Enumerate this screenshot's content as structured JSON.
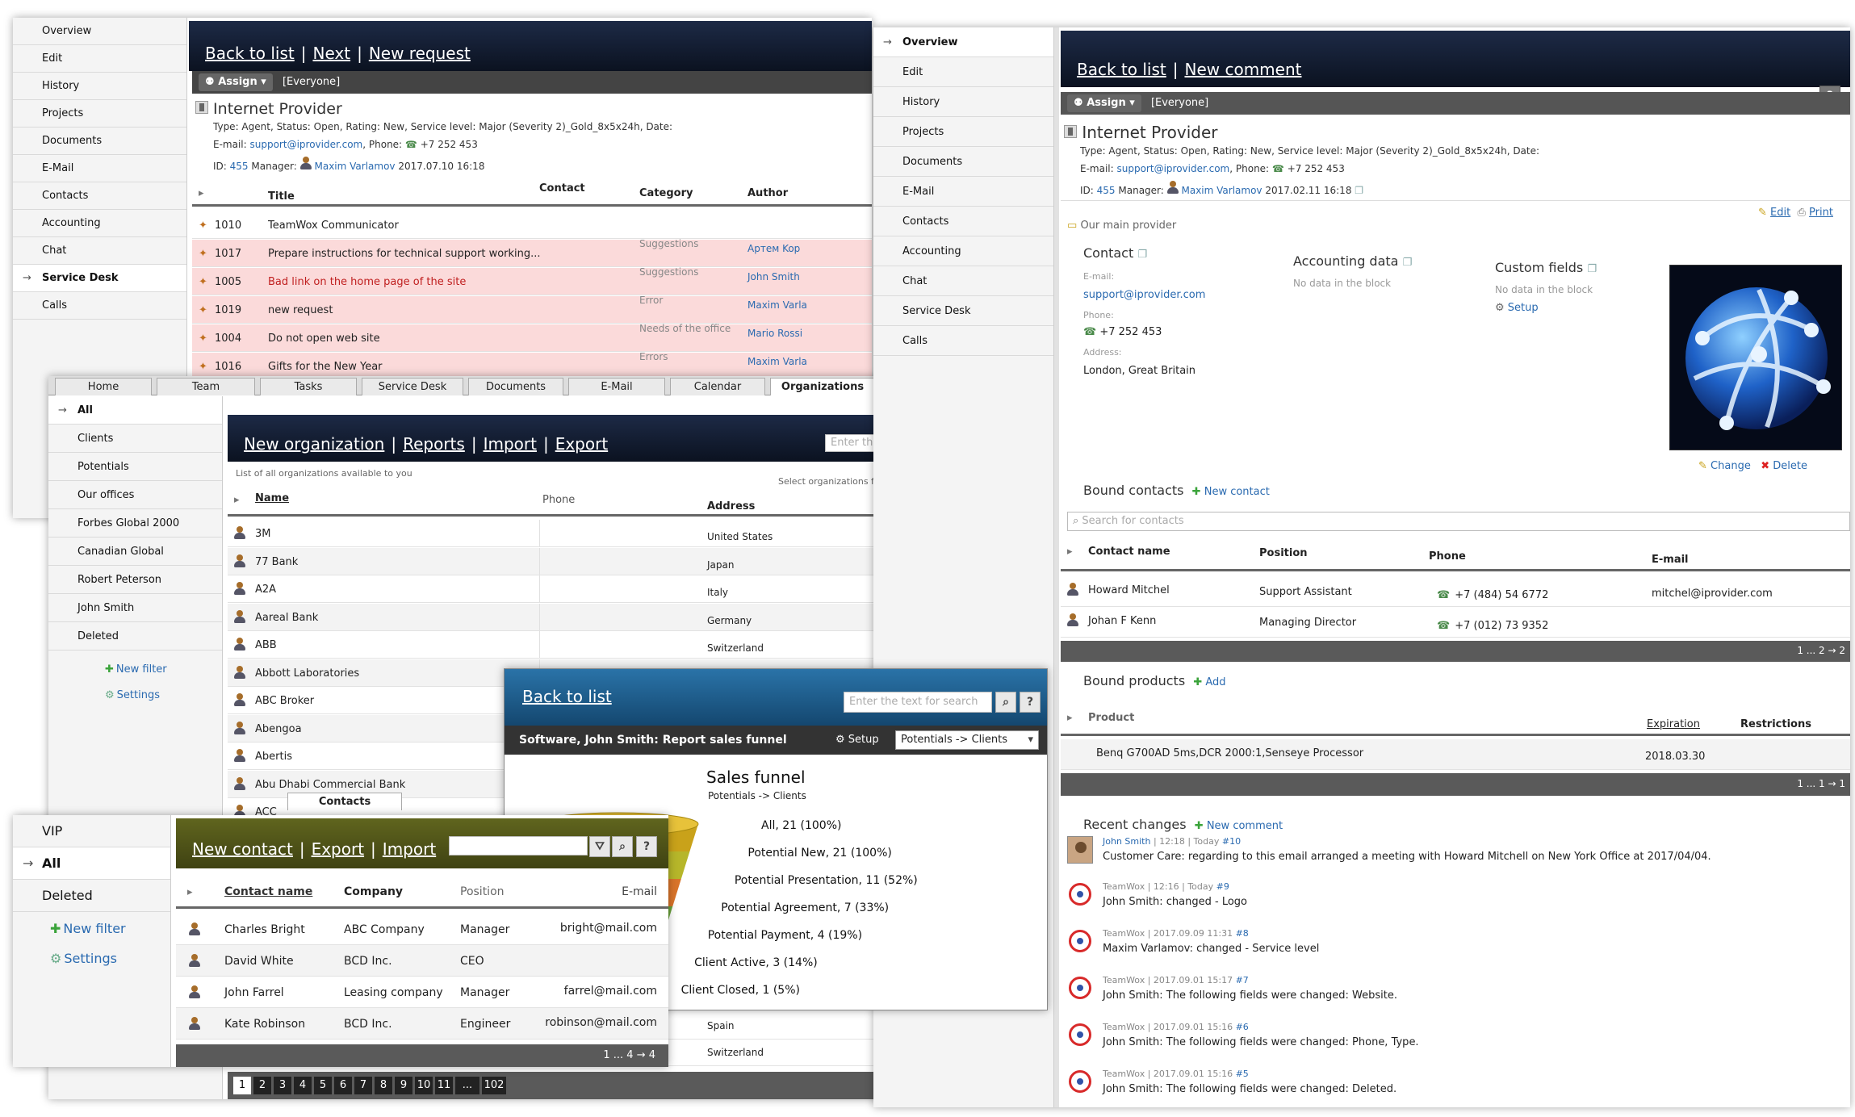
{
  "w1": {
    "sidebar": [
      "Overview",
      "Edit",
      "History",
      "Projects",
      "Documents",
      "E-Mail",
      "Contacts",
      "Accounting",
      "Chat",
      "Service Desk",
      "Calls"
    ],
    "links": [
      "Back to list",
      "Next",
      "New request"
    ],
    "assign": "Assign",
    "everyone": "[Everyone]",
    "org_name": "Internet Provider",
    "l1": "Type: Agent, Status: Open, Rating: New, Service level: Major (Severity 2)_Gold_8x5x24h, Date:",
    "email_lbl": "E-mail:",
    "email": "support@iprovider.com",
    "phone_lbl": ", Phone:",
    "phone": "+7 252 453",
    "id_lbl": "ID:",
    "id": "455",
    "mgr_lbl": "Manager:",
    "mgr": "Maxim Varlamov",
    "date": "2017.07.10 16:18",
    "cols": [
      "Title",
      "Contact",
      "Category",
      "Author"
    ],
    "rows": [
      {
        "id": "1010",
        "title": "TeamWox Communicator",
        "cat": "",
        "author": ""
      },
      {
        "id": "1017",
        "title": "Prepare instructions for technical support working...",
        "cat": "Suggestions",
        "author": "Артем Kop"
      },
      {
        "id": "1005",
        "title": "Bad link on the home page of the site",
        "cat": "Suggestions",
        "author": "John Smith"
      },
      {
        "id": "1019",
        "title": "new request",
        "cat": "Error",
        "author": "Maxim Varla"
      },
      {
        "id": "1004",
        "title": "Do not open web site",
        "cat": "Needs of the office",
        "author": "Mario Rossi"
      },
      {
        "id": "1016",
        "title": "Gifts for the New Year",
        "cat": "Errors",
        "author": "Maxim Varla"
      }
    ],
    "lastcat": "Needs of the office",
    "lastauthor": "John Smith"
  },
  "w2": {
    "tabs": [
      "Home",
      "Team",
      "Tasks",
      "Service Desk",
      "Documents",
      "E-Mail",
      "Calendar",
      "Organizations"
    ],
    "sidebar": [
      "All",
      "Clients",
      "Potentials",
      "Our offices",
      "Forbes Global 2000",
      "Canadian Global",
      "Robert Peterson",
      "John Smith",
      "Deleted"
    ],
    "new_filter": "New filter",
    "settings": "Settings",
    "links": [
      "New organization",
      "Reports",
      "Import",
      "Export"
    ],
    "search_ph": "Enter th",
    "subtitle": "List of all organizations available to you",
    "select_note": "Select organizations f",
    "cols": [
      "Name",
      "Phone",
      "Address"
    ],
    "rows": [
      {
        "name": "3M",
        "addr": "United States"
      },
      {
        "name": "77 Bank",
        "addr": "Japan"
      },
      {
        "name": "A2A",
        "addr": "Italy"
      },
      {
        "name": "Aareal Bank",
        "addr": "Germany"
      },
      {
        "name": "ABB",
        "addr": "Switzerland"
      },
      {
        "name": "Abbott Laboratories",
        "addr": ""
      },
      {
        "name": "ABC Broker",
        "addr": ""
      },
      {
        "name": "Abengoa",
        "addr": ""
      },
      {
        "name": "Abertis",
        "addr": ""
      },
      {
        "name": "Abu Dhabi Commercial Bank",
        "addr": ""
      },
      {
        "name": "ACC",
        "addr": ""
      }
    ],
    "extra_addr": [
      "Spain",
      "Switzerland"
    ],
    "contacts_tab": "Contacts",
    "pages": [
      "1",
      "2",
      "3",
      "4",
      "5",
      "6",
      "7",
      "8",
      "9",
      "10",
      "11",
      "...",
      "102"
    ]
  },
  "w3": {
    "sidebar": [
      "Overview",
      "Edit",
      "History",
      "Projects",
      "Documents",
      "E-Mail",
      "Contacts",
      "Accounting",
      "Chat",
      "Service Desk",
      "Calls"
    ],
    "links": [
      "Back to list",
      "New comment"
    ],
    "help": "?",
    "assign": "Assign",
    "everyone": "[Everyone]",
    "org_name": "Internet Provider",
    "l1": "Type: Agent, Status: Open, Rating: New, Service level: Major (Severity 2)_Gold_8x5x24h, Date:",
    "email_lbl": "E-mail:",
    "email": "support@iprovider.com",
    "phone_lbl": ", Phone:",
    "phone": "+7 252 453",
    "id_lbl": "ID:",
    "id": "455",
    "mgr_lbl": "Manager:",
    "mgr": "Maxim Varlamov",
    "date": "2017.02.11 16:18",
    "edit": "Edit",
    "print": "Print",
    "main_provider": "Our main provider",
    "contact_h": "Contact",
    "email_small": "E-mail:",
    "email_val": "support@iprovider.com",
    "phone_small": "Phone:",
    "phone_val": "+7 252 453",
    "addr_small": "Address:",
    "addr_val": "London, Great Britain",
    "acc_h": "Accounting data",
    "acc_nodata": "No data in the block",
    "cf_h": "Custom fields",
    "cf_nodata": "No data in the block",
    "setup": "Setup",
    "change": "Change",
    "delete": "Delete",
    "bound_contacts": "Bound contacts",
    "new_contact": "New contact",
    "search_contacts": "Search for contacts",
    "bc_cols": [
      "Contact name",
      "Position",
      "Phone",
      "E-mail"
    ],
    "bc_rows": [
      {
        "name": "Howard Mitchel",
        "pos": "Support Assistant",
        "phone": "+7 (484) 54 6772",
        "email": "mitchel@iprovider.com"
      },
      {
        "name": "Johan F Kenn",
        "pos": "Managing Director",
        "phone": "+7 (012) 73 9352",
        "email": ""
      }
    ],
    "bc_pager": "1 ... 2 → 2",
    "bound_products": "Bound products",
    "add": "Add",
    "bp_cols": [
      "Product",
      "Expiration",
      "Restrictions"
    ],
    "bp_row": {
      "product": "Benq G700AD 5ms,DCR 2000:1,Senseye Processor",
      "exp": "2018.03.30"
    },
    "bp_pager": "1 ... 1 → 1",
    "recent": "Recent changes",
    "new_comment": "New comment",
    "changes": [
      {
        "meta_a": "John Smith",
        "meta_b": " | 12:18 | Today ",
        "num": "#10",
        "text": "Customer Care: regarding to this email arranged a meeting with Howard Mitchell on New York Office at 2017/04/04."
      },
      {
        "meta_a": "TeamWox",
        "meta_b": " | 12:16 | Today ",
        "num": "#9",
        "text": "John Smith: changed - Logo"
      },
      {
        "meta_a": "TeamWox",
        "meta_b": " | 2017.09.09 11:31 ",
        "num": "#8",
        "text": "Maxim Varlamov: changed - Service level"
      },
      {
        "meta_a": "TeamWox",
        "meta_b": " | 2017.09.01 15:17 ",
        "num": "#7",
        "text": "John Smith: The following fields were changed: Website."
      },
      {
        "meta_a": "TeamWox",
        "meta_b": " | 2017.09.01 15:16 ",
        "num": "#6",
        "text": "John Smith: The following fields were changed: Phone, Type."
      },
      {
        "meta_a": "TeamWox",
        "meta_b": " | 2017.09.01 15:16 ",
        "num": "#5",
        "text": "John Smith: The following fields were changed: Deleted."
      }
    ]
  },
  "w4": {
    "back": "Back to list",
    "search_ph": "Enter the text for search",
    "help": "?",
    "report_title": "Software, John Smith: Report sales funnel",
    "setup": "Setup",
    "select": "Potentials -> Clients",
    "funnel_title": "Sales funnel",
    "funnel_sub": "Potentials -> Clients",
    "stages": [
      {
        "label": "All, 21 (100%)",
        "value": 21,
        "color": "#c9a21a"
      },
      {
        "label": "Potential New, 21 (100%)",
        "value": 21,
        "color": "#b6b62a"
      },
      {
        "label": "Potential Presentation, 11 (52%)",
        "value": 11,
        "color": "#d9742a"
      },
      {
        "label": "Potential Agreement, 7 (33%)",
        "value": 7,
        "color": "#6aa33a"
      },
      {
        "label": "Potential Payment, 4 (19%)",
        "value": 4,
        "color": "#4f86c8"
      },
      {
        "label": "Client Active, 3 (14%)",
        "value": 3,
        "color": "#8aa0b6"
      },
      {
        "label": "Client Closed, 1 (5%)",
        "value": 1,
        "color": "#b58a3a"
      }
    ]
  },
  "w5": {
    "sidebar": [
      "VIP",
      "All",
      "Deleted"
    ],
    "new_filter": "New filter",
    "settings": "Settings",
    "links": [
      "New contact",
      "Export",
      "Import"
    ],
    "help": "?",
    "cols": [
      "Contact name",
      "Company",
      "Position",
      "E-mail"
    ],
    "rows": [
      {
        "name": "Charles Bright",
        "company": "ABC Company",
        "pos": "Manager",
        "email": "bright@mail.com"
      },
      {
        "name": "David White",
        "company": "BCD Inc.",
        "pos": "CEO",
        "email": ""
      },
      {
        "name": "John Farrel",
        "company": "Leasing company",
        "pos": "Manager",
        "email": "farrel@mail.com"
      },
      {
        "name": "Kate Robinson",
        "company": "BCD Inc.",
        "pos": "Engineer",
        "email": "robinson@mail.com"
      }
    ],
    "pager": "1 ... 4 → 4"
  },
  "colors": {
    "header_dark": "#14203a",
    "header_olive": "#4d5118",
    "header_blue": "#1f5f8f",
    "link": "#2a6ab0",
    "error_row": "#fbdada"
  }
}
